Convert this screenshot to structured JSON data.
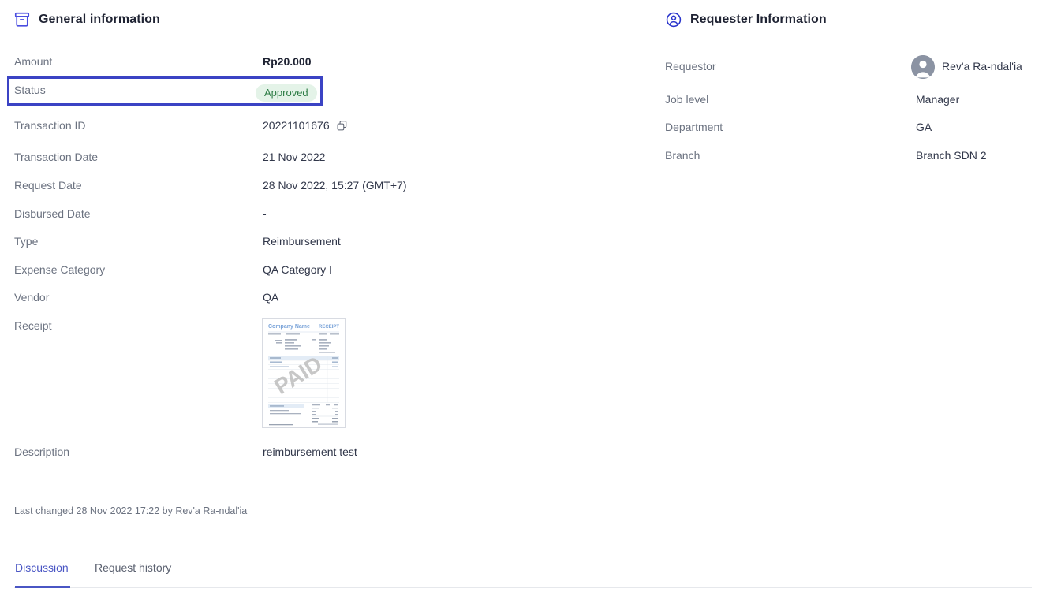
{
  "general": {
    "header": {
      "title": "General information",
      "icon": "archive-box-icon"
    },
    "fields": [
      {
        "label": "Amount",
        "value": "Rp20.000",
        "bold": true
      },
      {
        "label": "Status",
        "value": "Approved",
        "badge": true
      },
      {
        "label": "Transaction ID",
        "value": "20221101676",
        "copy": true
      },
      {
        "label": "Transaction Date",
        "value": "21 Nov 2022"
      },
      {
        "label": "Request Date",
        "value": "28 Nov 2022, 15:27 (GMT+7)"
      },
      {
        "label": "Disbursed Date",
        "value": "-"
      },
      {
        "label": "Type",
        "value": "Reimbursement"
      },
      {
        "label": "Expense Category",
        "value": "QA Category I"
      },
      {
        "label": "Vendor",
        "value": "QA"
      },
      {
        "label": "Receipt",
        "value": ""
      },
      {
        "label": "Description",
        "value": "reimbursement test"
      }
    ],
    "receipt": {
      "company": "Company Name",
      "doc_title": "RECEIPT",
      "watermark": "PAID"
    }
  },
  "requester": {
    "header": {
      "title": "Requester Information",
      "icon": "user-circle-icon"
    },
    "fields": [
      {
        "label": "Requestor",
        "value": "Rev'a Ra-ndal'ia",
        "avatar": true
      },
      {
        "label": "Job level",
        "value": "Manager"
      },
      {
        "label": "Department",
        "value": "GA"
      },
      {
        "label": "Branch",
        "value": "Branch SDN 2"
      }
    ]
  },
  "footer": {
    "last_changed": "Last changed 28 Nov 2022 17:22 by Rev'a Ra-ndal'ia"
  },
  "tabs": [
    {
      "label": "Discussion",
      "active": true
    },
    {
      "label": "Request history",
      "active": false
    }
  ],
  "colors": {
    "accent": "#4a56c4",
    "highlight_border": "#3b43c4",
    "badge_bg": "#e4f3e8",
    "badge_text": "#2e7d46",
    "label": "#6b7280",
    "value": "#31374a"
  }
}
